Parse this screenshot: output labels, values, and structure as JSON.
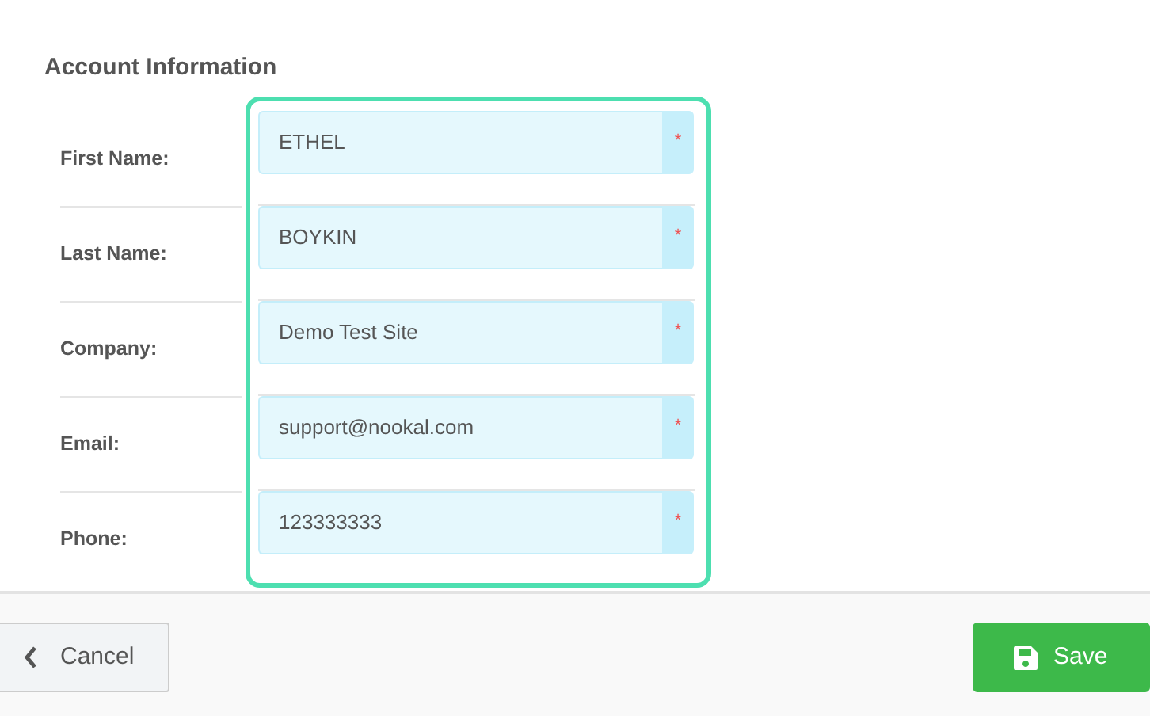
{
  "section_title": "Account Information",
  "fields": [
    {
      "label": "First Name:",
      "value": "ETHEL",
      "required_mark": "*"
    },
    {
      "label": "Last Name:",
      "value": "BOYKIN",
      "required_mark": "*"
    },
    {
      "label": "Company:",
      "value": "Demo Test Site",
      "required_mark": "*"
    },
    {
      "label": "Email:",
      "value": "support@nookal.com",
      "required_mark": "*"
    },
    {
      "label": "Phone:",
      "value": "123333333",
      "required_mark": "*"
    }
  ],
  "buttons": {
    "cancel": "Cancel",
    "save": "Save"
  }
}
